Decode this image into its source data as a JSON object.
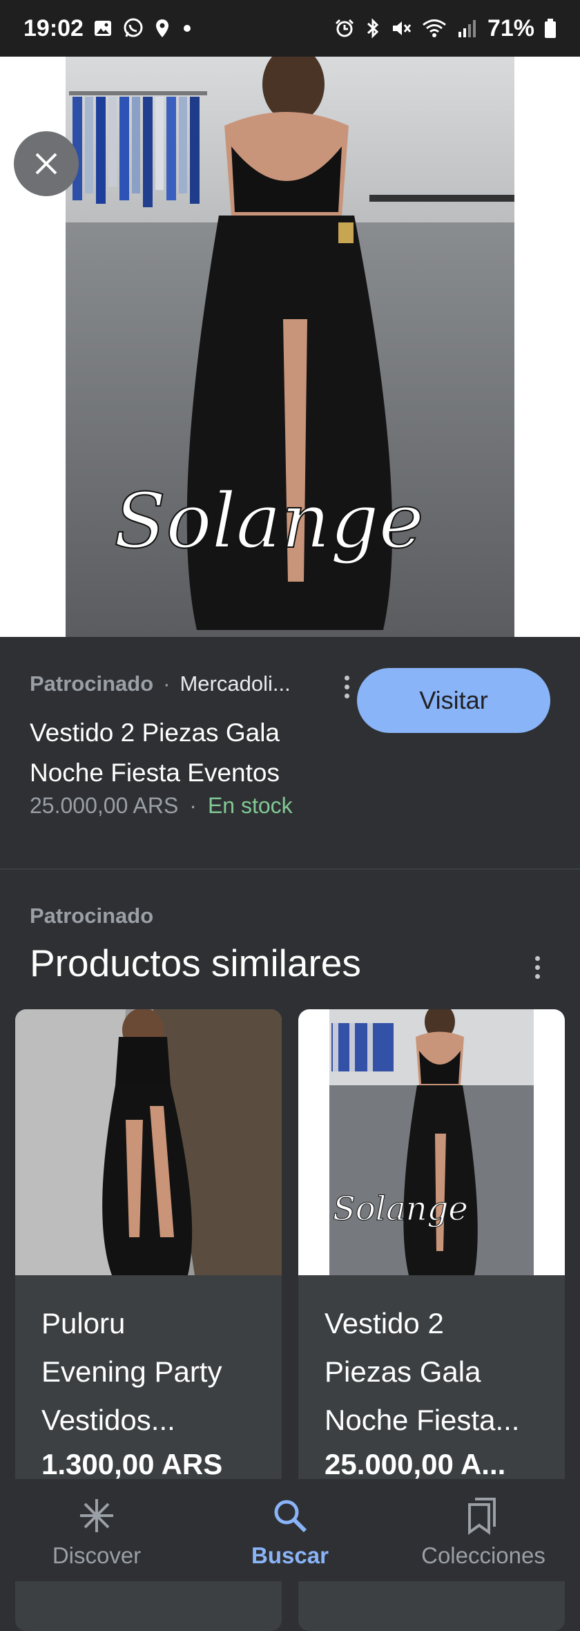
{
  "status_bar": {
    "time": "19:02",
    "battery": "71%",
    "left_icons": [
      "image-icon",
      "whatsapp-icon",
      "location-icon",
      "dot-icon"
    ],
    "right_icons": [
      "alarm-icon",
      "bluetooth-icon",
      "mute-icon",
      "wifi-icon",
      "signal-icon",
      "battery-icon"
    ]
  },
  "hero": {
    "watermark": "Solange"
  },
  "product": {
    "sponsored": "Patrocinado",
    "separator": "·",
    "merchant": "Mercadoli...",
    "visit_label": "Visitar",
    "title": "Vestido 2 Piezas Gala Noche Fiesta Eventos",
    "price": "25.000,00 ARS",
    "price_separator": "·",
    "stock": "En stock"
  },
  "similar": {
    "sponsored": "Patrocinado",
    "title": "Productos similares",
    "cards": [
      {
        "title_lines": [
          "Puloru",
          "Evening Party",
          "Vestidos..."
        ],
        "price": "1.300,00 ARS"
      },
      {
        "title_lines": [
          "Vestido 2",
          "Piezas Gala",
          "Noche Fiesta..."
        ],
        "price": "25.000,00 A...",
        "watermark": "Solange"
      }
    ]
  },
  "bottom_nav": {
    "items": [
      {
        "label": "Discover",
        "icon": "asterisk-icon"
      },
      {
        "label": "Buscar",
        "icon": "search-icon"
      },
      {
        "label": "Colecciones",
        "icon": "collections-icon"
      }
    ],
    "active": "Buscar"
  },
  "colors": {
    "accent": "#8ab4f8",
    "stock_green": "#81c995",
    "background": "#2f3033"
  }
}
